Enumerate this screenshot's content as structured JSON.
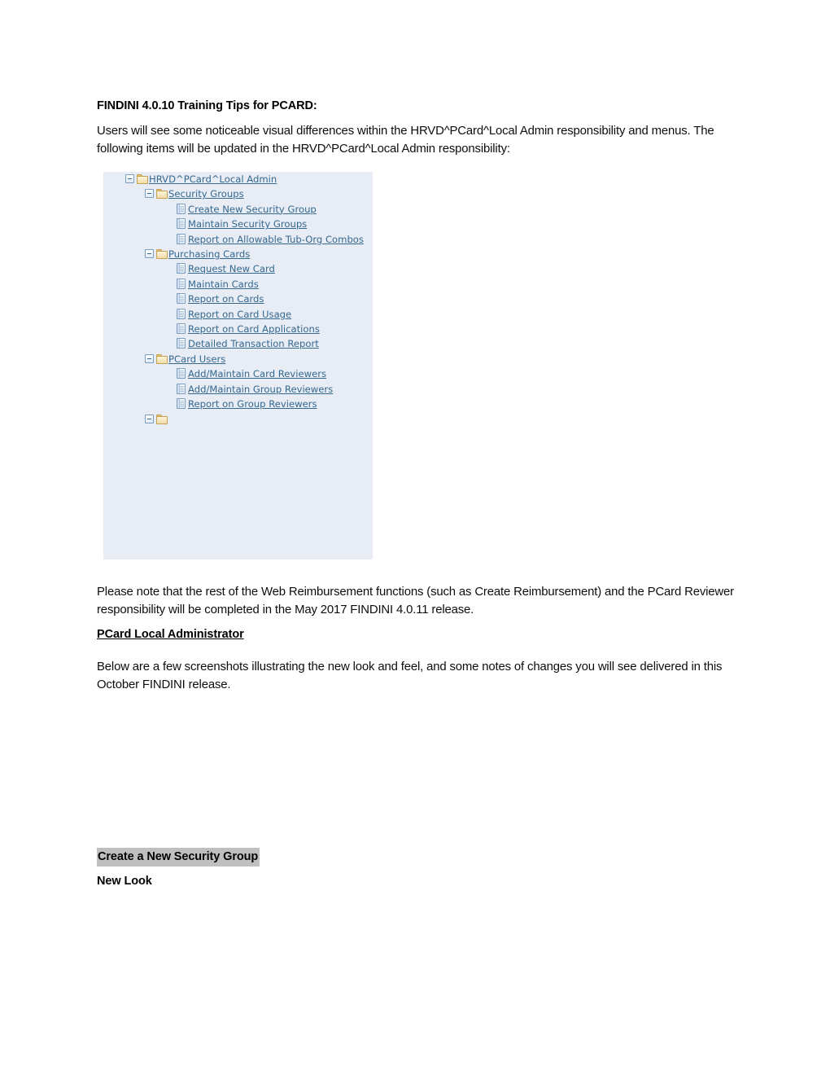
{
  "document": {
    "heading": "FINDINI 4.0.10 Training Tips for PCARD:",
    "intro_paragraph": "Users will see some noticeable visual differences within the HRVD^PCard^Local Admin responsibility and menus.  The following items will be updated in the HRVD^PCard^Local Admin responsibility:",
    "note_paragraph": "Please note that the rest of the Web Reimbursement functions (such as Create Reimbursement) and the PCard Reviewer responsibility will be completed in the May 2017 FINDINI 4.0.11 release.",
    "subheading": "PCard Local Administrator",
    "screenshots_paragraph": "Below are a few screenshots illustrating the new look and feel, and some notes of changes you will see delivered in this October FINDINI release.",
    "highlighted_heading": "Create a New Security Group",
    "new_look_label": "New Look"
  },
  "tree_figure": {
    "background_color": "#e7ecf5",
    "link_color": "#35688f",
    "nodes": [
      {
        "level": 0,
        "icon": "folder-icon",
        "toggle": "minus",
        "label": "HRVD^PCard^Local Admin"
      },
      {
        "level": 1,
        "icon": "folder-icon",
        "toggle": "minus",
        "label": "Security Groups"
      },
      {
        "level": 2,
        "icon": "page-icon",
        "toggle": "none",
        "label": "Create New Security Group"
      },
      {
        "level": 2,
        "icon": "page-icon",
        "toggle": "none",
        "label": "Maintain Security Groups"
      },
      {
        "level": 2,
        "icon": "page-icon",
        "toggle": "none",
        "label": "Report on Allowable Tub-Org Combos"
      },
      {
        "level": 1,
        "icon": "folder-icon",
        "toggle": "minus",
        "label": "Purchasing Cards"
      },
      {
        "level": 2,
        "icon": "page-icon",
        "toggle": "none",
        "label": "Request New Card"
      },
      {
        "level": 2,
        "icon": "page-icon",
        "toggle": "none",
        "label": "Maintain Cards"
      },
      {
        "level": 2,
        "icon": "page-icon",
        "toggle": "none",
        "label": "Report on Cards"
      },
      {
        "level": 2,
        "icon": "page-icon",
        "toggle": "none",
        "label": "Report on Card Usage"
      },
      {
        "level": 2,
        "icon": "page-icon",
        "toggle": "none",
        "label": "Report on Card Applications"
      },
      {
        "level": 2,
        "icon": "page-icon",
        "toggle": "none",
        "label": "Detailed Transaction Report"
      },
      {
        "level": 1,
        "icon": "folder-icon",
        "toggle": "minus",
        "label": "PCard Users"
      },
      {
        "level": 2,
        "icon": "page-icon",
        "toggle": "none",
        "label": "Add/Maintain Card Reviewers"
      },
      {
        "level": 2,
        "icon": "page-icon",
        "toggle": "none",
        "label": "Add/Maintain Group Reviewers"
      },
      {
        "level": 2,
        "icon": "page-icon",
        "toggle": "none",
        "label": "Report on Group Reviewers"
      },
      {
        "level": 1,
        "icon": "folder-icon",
        "toggle": "minus",
        "label": ""
      }
    ]
  }
}
